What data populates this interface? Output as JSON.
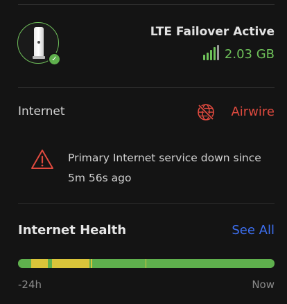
{
  "device": {
    "status_title": "LTE Failover Active",
    "data_usage": "2.03 GB",
    "icon": "lte-device",
    "status_icon": "check-badge-icon",
    "status_color": "#5fb04d"
  },
  "internet": {
    "label": "Internet",
    "isp_name": "Airwire",
    "isp_icon": "globe-offline-icon",
    "isp_color": "#e04a3f"
  },
  "alert": {
    "icon": "warning-triangle-icon",
    "message": "Primary Internet service down since 5m 56s ago"
  },
  "health": {
    "title": "Internet Health",
    "see_all_label": "See All",
    "range_start": "-24h",
    "range_end": "Now",
    "colors": {
      "good": "#5fb04d",
      "degraded": "#d9c43a"
    },
    "timeline": [
      {
        "state": "good",
        "fraction": 0.05
      },
      {
        "state": "degraded",
        "fraction": 0.065
      },
      {
        "state": "good",
        "fraction": 0.018
      },
      {
        "state": "degraded",
        "fraction": 0.145
      },
      {
        "state": "good",
        "fraction": 0.006
      },
      {
        "state": "degraded",
        "fraction": 0.006
      },
      {
        "state": "good",
        "fraction": 0.206
      },
      {
        "state": "degraded",
        "fraction": 0.004
      },
      {
        "state": "good",
        "fraction": 0.5
      }
    ]
  }
}
